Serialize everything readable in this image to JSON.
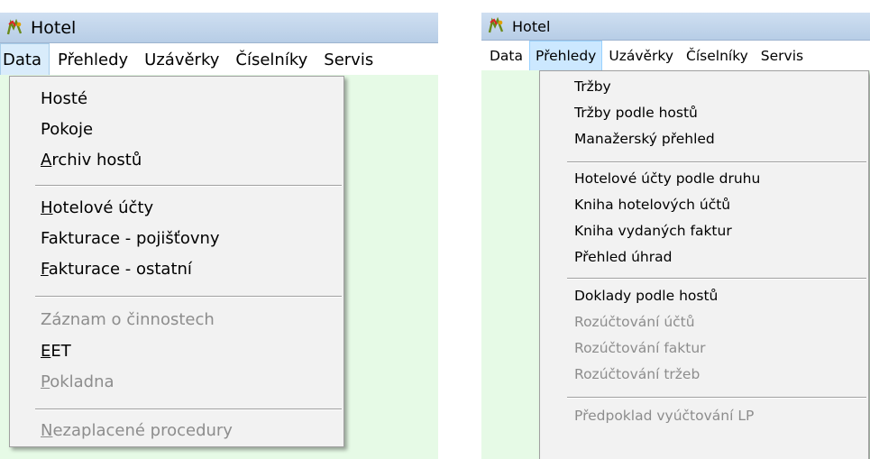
{
  "left_window": {
    "title": "Hotel",
    "app_icon": "hotel-app-icon",
    "menubar": [
      {
        "label": "Data",
        "active": true
      },
      {
        "label": "Přehledy"
      },
      {
        "label": "Uzávěrky"
      },
      {
        "label": "Číselníky"
      },
      {
        "label": "Servis"
      }
    ],
    "dropdown": {
      "items": [
        {
          "label": "Hosté",
          "enabled": true
        },
        {
          "label": "Pokoje",
          "enabled": true
        },
        {
          "label": "Archiv hostů",
          "enabled": true,
          "mnemonic": "A"
        },
        {
          "label": "Hotelové účty",
          "enabled": true,
          "mnemonic": "H"
        },
        {
          "label": "Fakturace - pojišťovny",
          "enabled": true
        },
        {
          "label": "Fakturace - ostatní",
          "enabled": true,
          "mnemonic": "F"
        },
        {
          "label": "Záznam o činnostech",
          "enabled": false
        },
        {
          "label": "EET",
          "enabled": true,
          "mnemonic": "E"
        },
        {
          "label": "Pokladna",
          "enabled": false,
          "mnemonic": "P"
        },
        {
          "label": "Nezaplacené procedury",
          "enabled": false,
          "mnemonic": "N"
        }
      ]
    }
  },
  "right_window": {
    "title": "Hotel",
    "app_icon": "hotel-app-icon",
    "menubar": [
      {
        "label": "Data"
      },
      {
        "label": "Přehledy",
        "active": true
      },
      {
        "label": "Uzávěrky"
      },
      {
        "label": "Číselníky"
      },
      {
        "label": "Servis"
      }
    ],
    "dropdown": {
      "items": [
        {
          "label": "Tržby",
          "enabled": true
        },
        {
          "label": "Tržby podle hostů",
          "enabled": true
        },
        {
          "label": "Manažerský přehled",
          "enabled": true
        },
        {
          "label": "Hotelové účty podle druhu",
          "enabled": true
        },
        {
          "label": "Kniha hotelových účtů",
          "enabled": true
        },
        {
          "label": "Kniha vydaných faktur",
          "enabled": true
        },
        {
          "label": "Přehled úhrad",
          "enabled": true
        },
        {
          "label": "Doklady podle hostů",
          "enabled": true
        },
        {
          "label": "Rozúčtování účtů",
          "enabled": false
        },
        {
          "label": "Rozúčtování faktur",
          "enabled": false
        },
        {
          "label": "Rozúčtování tržeb",
          "enabled": false
        },
        {
          "label": "Předpoklad vyúčtování LP",
          "enabled": false
        }
      ]
    }
  },
  "colors": {
    "titlebar": "#c3d6ed",
    "client_area": "#e6fae6",
    "menu_background": "#f2f2f2",
    "disabled_text": "#8d8d8d",
    "active_menu": "#cce8ff"
  }
}
